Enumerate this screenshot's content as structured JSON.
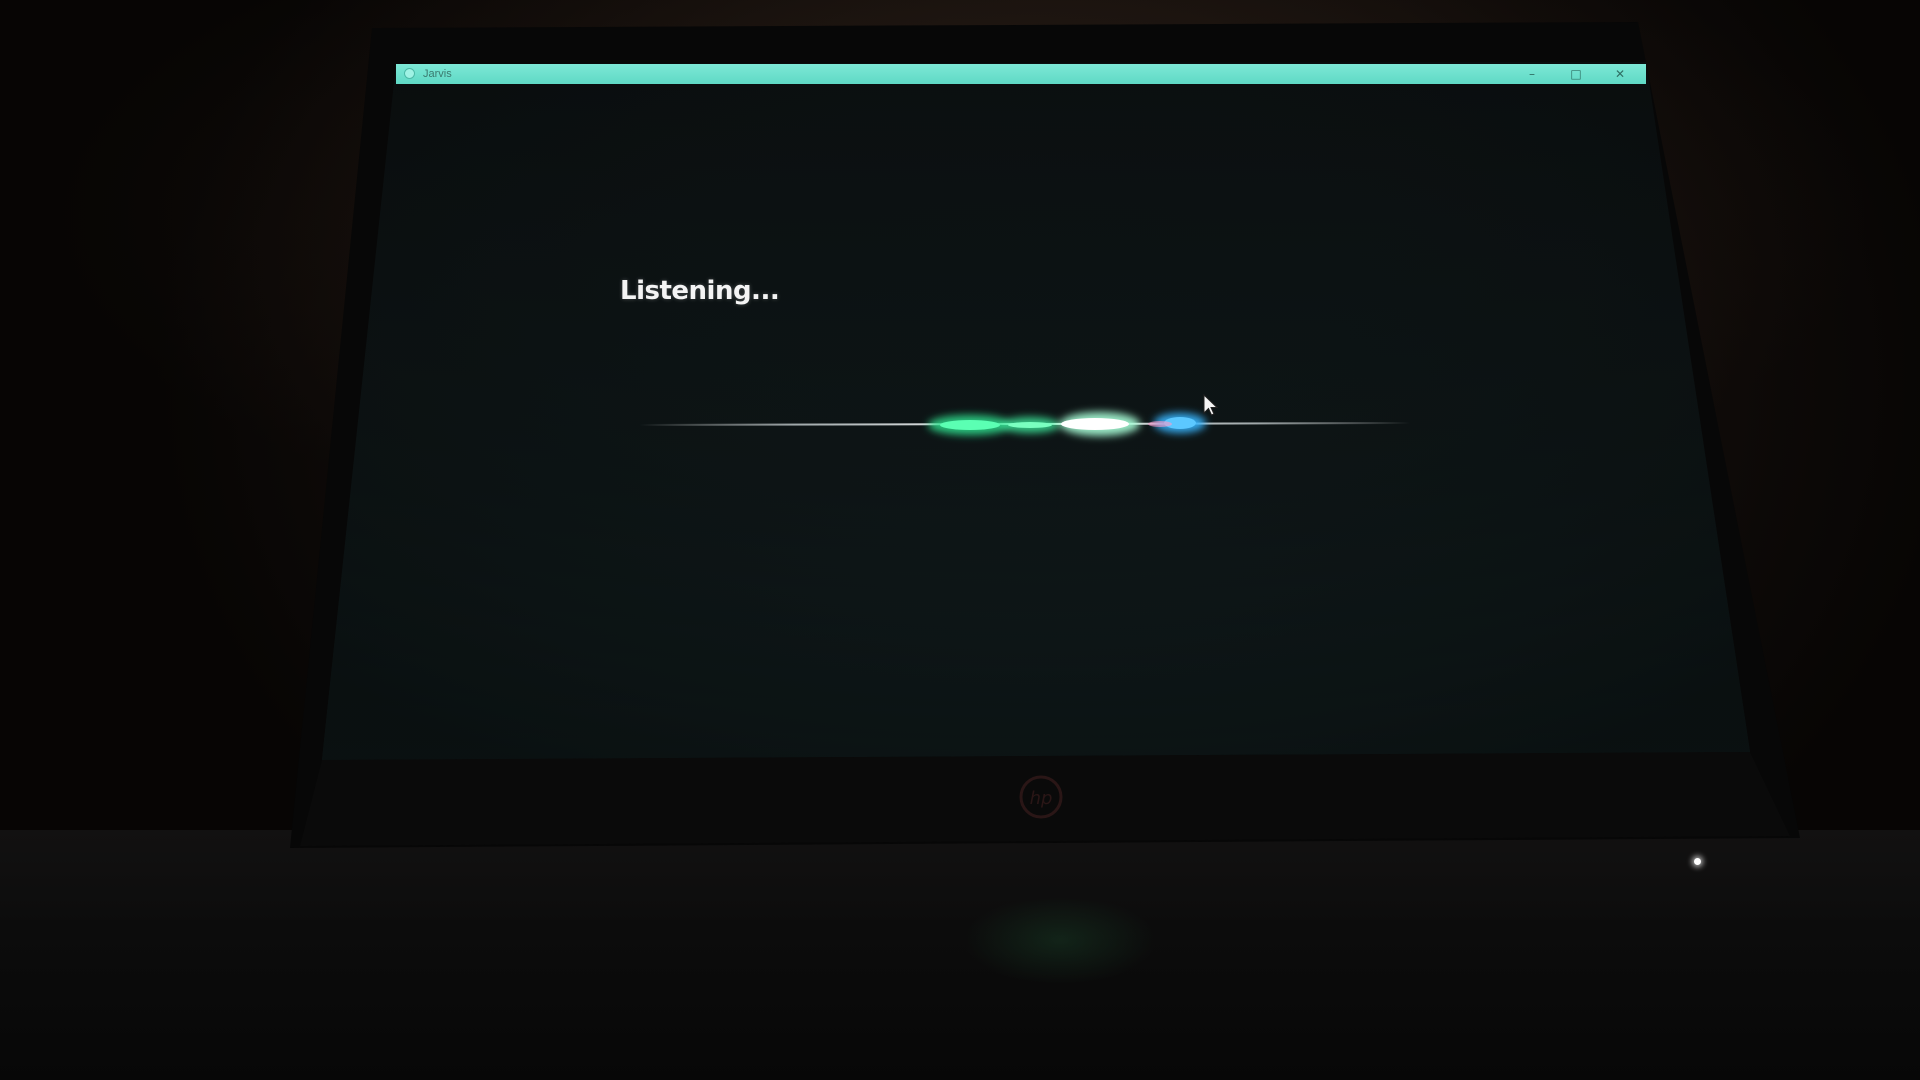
{
  "window": {
    "title": "Jarvis",
    "minimize_glyph": "–",
    "maximize_glyph": "□",
    "close_glyph": "✕",
    "titlebar_color": "#6fe0cd"
  },
  "assistant": {
    "status_text": "Listening..."
  },
  "colors": {
    "background": "#0b0f10",
    "wave_green": "#3ef0a0",
    "wave_blue": "#37b6ff",
    "wave_white": "#ffffff"
  },
  "icons": {
    "app": "jarvis-app-icon",
    "cursor": "mouse-pointer-icon",
    "brand": "hp-logo-icon"
  }
}
